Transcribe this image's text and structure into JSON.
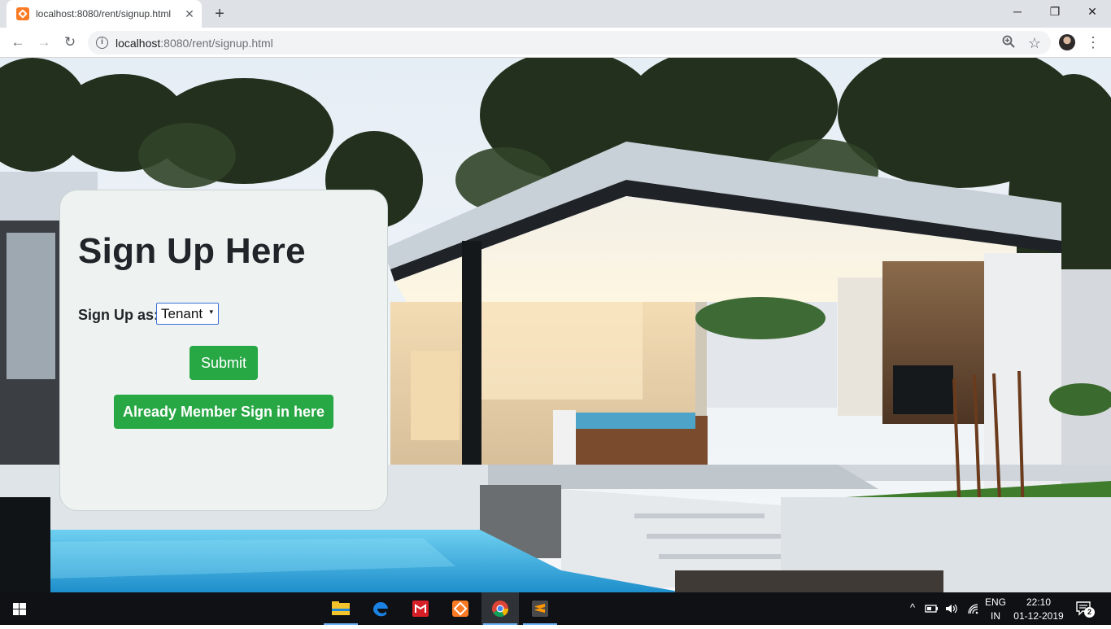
{
  "browser": {
    "tab": {
      "title": "localhost:8080/rent/signup.html",
      "close": "✕",
      "favicon": "xampp-icon"
    },
    "new_tab": "+",
    "window_controls": {
      "minimize": "─",
      "restore": "❐",
      "close": "✕"
    },
    "nav": {
      "back": "←",
      "forward": "→",
      "reload": "↻"
    },
    "address": {
      "host": "localhost",
      "rest": ":8080/rent/signup.html"
    },
    "omnibox_icons": {
      "info": "i",
      "zoom": "zoom-icon",
      "bookmark": "☆"
    },
    "menu": "⋮"
  },
  "page": {
    "heading": "Sign Up Here",
    "signup_as_label": "Sign Up as:",
    "role_select": {
      "selected": "Tenant",
      "caret": "▾"
    },
    "submit_label": "Submit",
    "signin_label": "Already Member Sign in here",
    "accent": "#28a745"
  },
  "taskbar": {
    "apps": [
      "file-explorer-icon",
      "edge-icon",
      "reader-icon",
      "xampp-icon",
      "chrome-icon",
      "sublime-text-icon"
    ],
    "tray": {
      "chevron": "^",
      "language": "ENG",
      "region": "IN",
      "time": "22:10",
      "date": "01-12-2019",
      "notifications": "2"
    }
  }
}
